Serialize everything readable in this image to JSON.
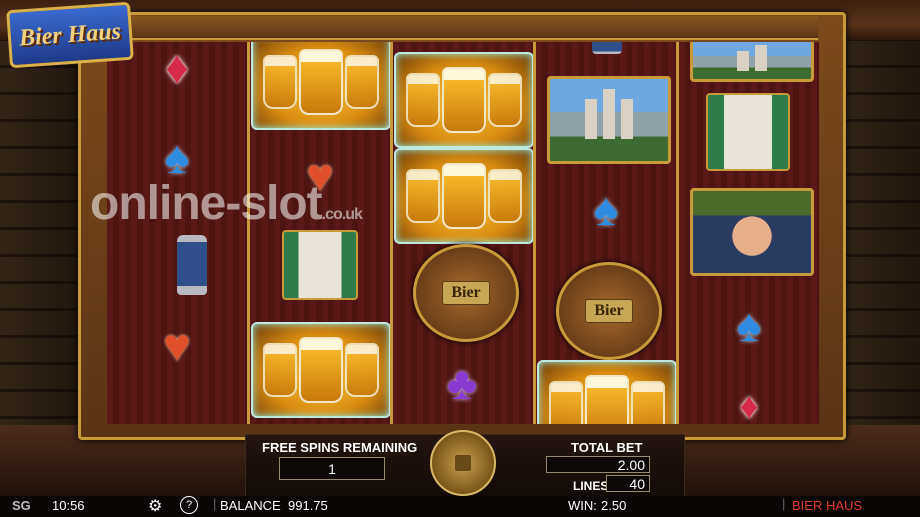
{
  "game": {
    "logo_text": "Bier Haus",
    "watermark_main": "online-slot",
    "watermark_suffix": ".co.uk"
  },
  "reels": [
    [
      "diamond",
      "spade",
      "stein",
      "heart"
    ],
    [
      "beer",
      "heart",
      "accordion",
      "beer"
    ],
    [
      "beer",
      "beer",
      "bier-barrel",
      "club"
    ],
    [
      "beer",
      "castle",
      "spade",
      "bier-barrel",
      "beer"
    ],
    [
      "castle",
      "accordion",
      "bavarian-man",
      "spade",
      "diamond"
    ]
  ],
  "symbols": {
    "bier_barrel_label": "Bier"
  },
  "panel": {
    "free_spins_label": "FREE SPINS REMAINING",
    "free_spins_value": "1",
    "total_bet_label": "TOTAL BET",
    "total_bet_value": "2.00",
    "lines_label": "LINES",
    "lines_value": "40"
  },
  "status_bar": {
    "brand": "SG",
    "time": "10:56",
    "settings_icon": "gear-icon",
    "help_icon": "help-icon",
    "balance_label": "BALANCE",
    "balance_value": "991.75",
    "win_label": "WIN:",
    "win_value": "2.50",
    "game_name": "BIER HAUS"
  },
  "colors": {
    "frame_gold": "#c99a3a",
    "reel_bg": "#5b1a16",
    "game_name_red": "#e03a2a"
  }
}
